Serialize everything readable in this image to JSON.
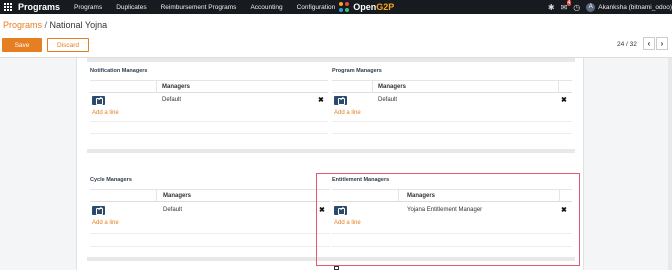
{
  "navbar": {
    "app_name": "Programs",
    "menu": [
      "Programs",
      "Duplicates",
      "Reimbursement Programs",
      "Accounting",
      "Configuration"
    ],
    "logo_a": "Open",
    "logo_b": "G2P",
    "message_count": "4",
    "avatar_letter": "A",
    "user_name": "Akanksha (bitnami_odoo)"
  },
  "breadcrumb": {
    "parent": "Programs",
    "separator": " / ",
    "current": "National Yojna"
  },
  "actions": {
    "save": "Save",
    "discard": "Discard"
  },
  "pager": {
    "text": "24 / 32",
    "prev": "‹",
    "next": "›"
  },
  "sections": {
    "notification": {
      "title": "Notification Managers",
      "header": "Managers",
      "rows": [
        "Default"
      ],
      "add_line": "Add a line"
    },
    "program": {
      "title": "Program Managers",
      "header": "Managers",
      "rows": [
        "Default"
      ],
      "add_line": "Add a line"
    },
    "cycle": {
      "title": "Cycle Managers",
      "header": "Managers",
      "rows": [
        "Default"
      ],
      "add_line": "Add a line"
    },
    "entitlement": {
      "title": "Entitlement Managers",
      "header": "Managers",
      "rows": [
        "Yojana Entitlement Manager"
      ],
      "add_line": "Add a line"
    }
  },
  "delete_glyph": "✖",
  "colors": {
    "accent": "#e67e22",
    "navbar": "#171a1e",
    "edit_button": "#2c4a6b",
    "highlight": "#e05b6e"
  }
}
